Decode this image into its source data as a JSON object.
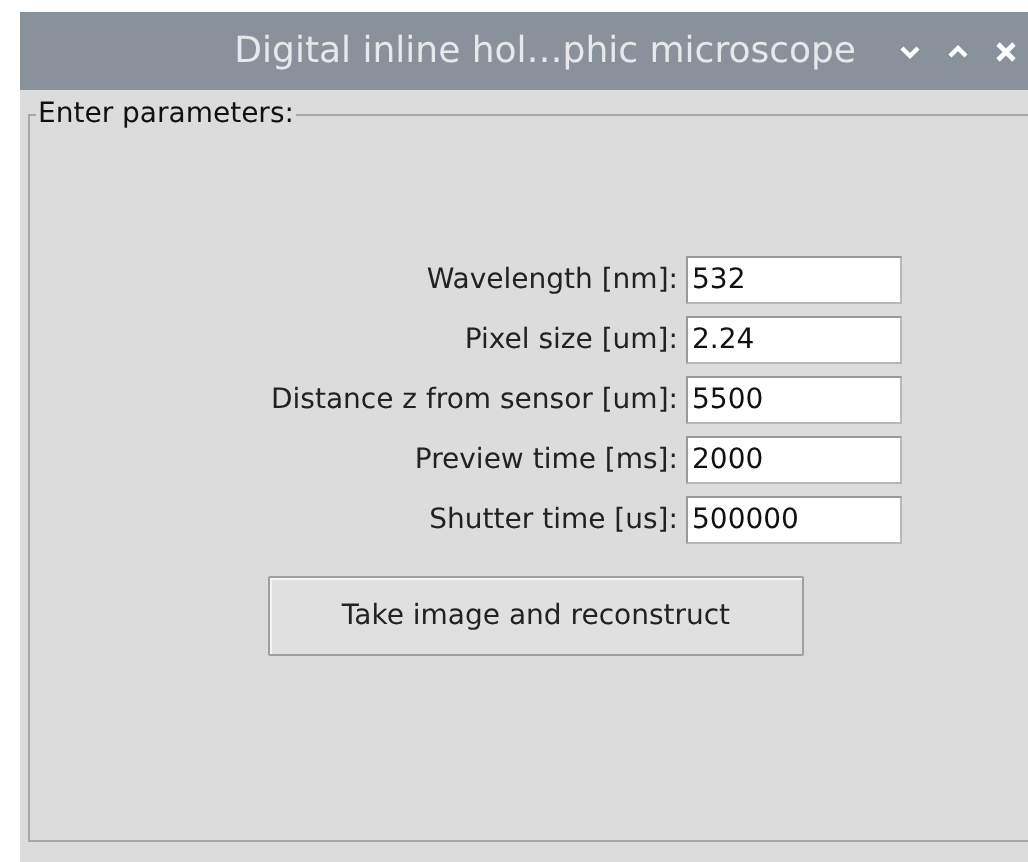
{
  "window": {
    "title": "Digital inline hol…phic microscope"
  },
  "group": {
    "title": "Enter parameters:"
  },
  "fields": [
    {
      "label": "Wavelength [nm]:",
      "value": "532"
    },
    {
      "label": "Pixel size [um]:",
      "value": "2.24"
    },
    {
      "label": "Distance z from sensor [um]:",
      "value": "5500"
    },
    {
      "label": "Preview time [ms]:",
      "value": "2000"
    },
    {
      "label": "Shutter time [us]:",
      "value": "500000"
    }
  ],
  "button": {
    "label": "Take image and reconstruct"
  }
}
